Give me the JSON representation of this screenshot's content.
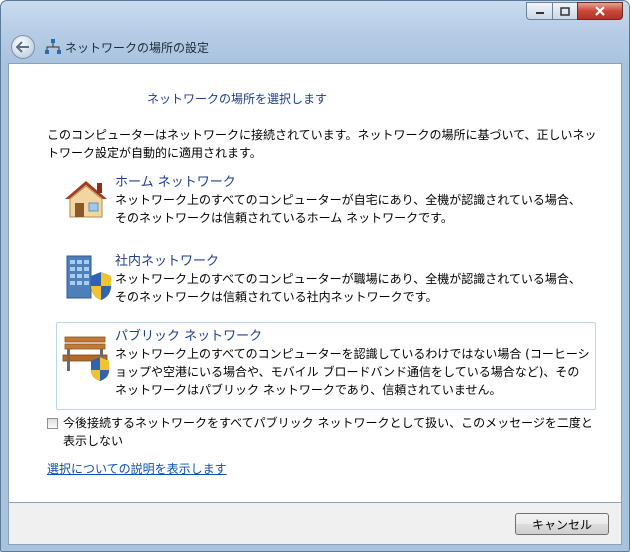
{
  "window": {
    "title": "ネットワークの場所の設定",
    "caption_buttons": [
      "minimize",
      "maximize",
      "close"
    ]
  },
  "main": {
    "heading": "ネットワークの場所を選択します",
    "intro": "このコンピューターはネットワークに接続されています。ネットワークの場所に基づいて、正しいネットワーク設定が自動的に適用されます。",
    "options": [
      {
        "icon": "house-icon",
        "title": "ホーム ネットワーク",
        "description": "ネットワーク上のすべてのコンピューターが自宅にあり、全機が認識されている場合、そのネットワークは信頼されているホーム ネットワークです。"
      },
      {
        "icon": "office-building-shield-icon",
        "title": "社内ネットワーク",
        "description": "ネットワーク上のすべてのコンピューターが職場にあり、全機が認識されている場合、そのネットワークは信頼されている社内ネットワークです。"
      },
      {
        "icon": "park-bench-shield-icon",
        "title": "パブリック ネットワーク",
        "description": "ネットワーク上のすべてのコンピューターを認識しているわけではない場合 (コーヒーショップや空港にいる場合や、モバイル ブロードバンド通信をしている場合など)、そのネットワークはパブリック ネットワークであり、信頼されていません。"
      }
    ],
    "checkbox": {
      "label": "今後接続するネットワークをすべてパブリック ネットワークとして扱い、このメッセージを二度と表示しない",
      "checked": false
    },
    "help_link": "選択についての説明を表示します"
  },
  "footer": {
    "cancel_label": "キャンセル"
  },
  "colors": {
    "title_blue": "#1f3f8a",
    "link_blue": "#0a4fb5",
    "frame": "#a9c3df"
  }
}
